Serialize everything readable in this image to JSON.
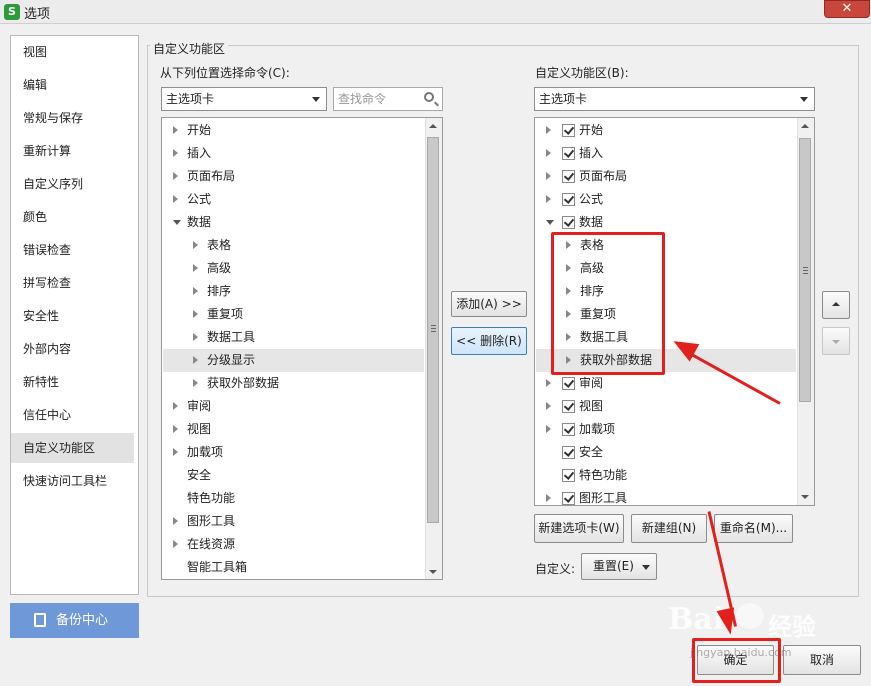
{
  "window": {
    "title": "选项",
    "app_icon": "S",
    "close_glyph": "✕"
  },
  "nav": {
    "items": [
      "视图",
      "编辑",
      "常规与保存",
      "重新计算",
      "自定义序列",
      "颜色",
      "错误检查",
      "拼写检查",
      "安全性",
      "外部内容",
      "新特性",
      "信任中心",
      "自定义功能区",
      "快速访问工具栏"
    ],
    "selected_index": 12,
    "backup_label": "备份中心"
  },
  "group_title": "自定义功能区",
  "left": {
    "label": "从下列位置选择命令(C):",
    "combo_value": "主选项卡",
    "search_placeholder": "查找命令",
    "items": [
      {
        "text": "开始",
        "level": 0,
        "expander": "closed"
      },
      {
        "text": "插入",
        "level": 0,
        "expander": "closed"
      },
      {
        "text": "页面布局",
        "level": 0,
        "expander": "closed"
      },
      {
        "text": "公式",
        "level": 0,
        "expander": "closed"
      },
      {
        "text": "数据",
        "level": 0,
        "expander": "open"
      },
      {
        "text": "表格",
        "level": 1,
        "expander": "closed"
      },
      {
        "text": "高级",
        "level": 1,
        "expander": "closed"
      },
      {
        "text": "排序",
        "level": 1,
        "expander": "closed"
      },
      {
        "text": "重复项",
        "level": 1,
        "expander": "closed"
      },
      {
        "text": "数据工具",
        "level": 1,
        "expander": "closed"
      },
      {
        "text": "分级显示",
        "level": 1,
        "expander": "closed",
        "highlight": true
      },
      {
        "text": "获取外部数据",
        "level": 1,
        "expander": "closed"
      },
      {
        "text": "审阅",
        "level": 0,
        "expander": "closed"
      },
      {
        "text": "视图",
        "level": 0,
        "expander": "closed"
      },
      {
        "text": "加载项",
        "level": 0,
        "expander": "closed"
      },
      {
        "text": "安全",
        "level": 0,
        "expander": "none"
      },
      {
        "text": "特色功能",
        "level": 0,
        "expander": "none"
      },
      {
        "text": "图形工具",
        "level": 0,
        "expander": "closed"
      },
      {
        "text": "在线资源",
        "level": 0,
        "expander": "closed"
      },
      {
        "text": "智能工具箱",
        "level": 0,
        "expander": "none"
      }
    ]
  },
  "middle": {
    "add_label": "添加(A) >>",
    "remove_label": "<< 删除(R)"
  },
  "right": {
    "label": "自定义功能区(B):",
    "combo_value": "主选项卡",
    "items": [
      {
        "text": "开始",
        "level": 0,
        "expander": "closed",
        "checked": true
      },
      {
        "text": "插入",
        "level": 0,
        "expander": "closed",
        "checked": true
      },
      {
        "text": "页面布局",
        "level": 0,
        "expander": "closed",
        "checked": true
      },
      {
        "text": "公式",
        "level": 0,
        "expander": "closed",
        "checked": true
      },
      {
        "text": "数据",
        "level": 0,
        "expander": "open",
        "checked": true
      },
      {
        "text": "表格",
        "level": 1,
        "expander": "closed"
      },
      {
        "text": "高级",
        "level": 1,
        "expander": "closed"
      },
      {
        "text": "排序",
        "level": 1,
        "expander": "closed"
      },
      {
        "text": "重复项",
        "level": 1,
        "expander": "closed"
      },
      {
        "text": "数据工具",
        "level": 1,
        "expander": "closed"
      },
      {
        "text": "获取外部数据",
        "level": 1,
        "expander": "closed",
        "highlight": true
      },
      {
        "text": "审阅",
        "level": 0,
        "expander": "closed",
        "checked": true
      },
      {
        "text": "视图",
        "level": 0,
        "expander": "closed",
        "checked": true
      },
      {
        "text": "加载项",
        "level": 0,
        "expander": "closed",
        "checked": true
      },
      {
        "text": "安全",
        "level": 0,
        "expander": "none",
        "checked": true
      },
      {
        "text": "特色功能",
        "level": 0,
        "expander": "none",
        "checked": true
      },
      {
        "text": "图形工具",
        "level": 0,
        "expander": "closed",
        "checked": true
      }
    ],
    "new_tab_label": "新建选项卡(W)",
    "new_group_label": "新建组(N)",
    "rename_label": "重命名(M)...",
    "customize_label": "自定义:",
    "reset_label": "重置(E)"
  },
  "footer": {
    "ok_label": "确定",
    "cancel_label": "取消"
  },
  "watermark": {
    "main": "Bai",
    "du": "经验",
    "sub": "jingyan.baidu.com"
  },
  "colors": {
    "accent_red": "#e3211c",
    "nav_button": "#6f98d8",
    "check": "#333333"
  },
  "icons": {
    "move_up": "up-arrow-icon",
    "move_down": "down-arrow-icon",
    "search": "magnifier-icon"
  }
}
